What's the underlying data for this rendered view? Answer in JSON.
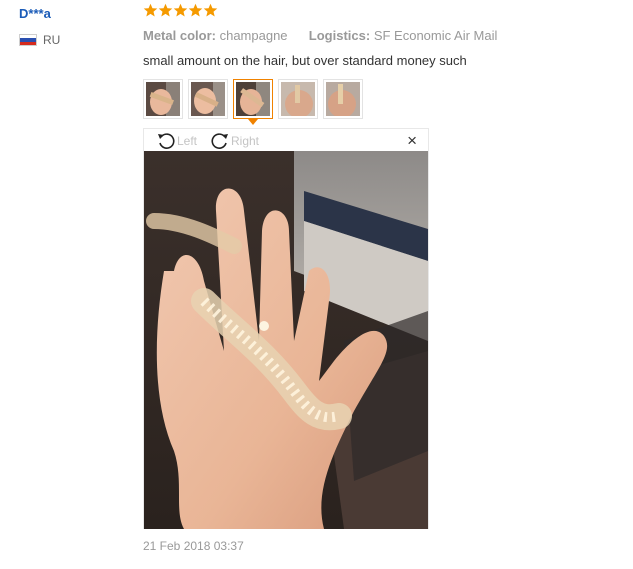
{
  "reviewer": {
    "name": "D***a",
    "country_code": "RU",
    "flag_colors": [
      "#ffffff",
      "#2a4fb0",
      "#d52b1e"
    ]
  },
  "rating": {
    "stars": 5,
    "max": 5,
    "color": "#f59a00"
  },
  "attributes": [
    {
      "key": "Metal color:",
      "value": "champagne"
    },
    {
      "key": "Logistics:",
      "value": "SF Economic Air Mail"
    }
  ],
  "review_text": "small amount on the hair, but over standard money such",
  "thumbnails": [
    {
      "icon": "review-photo-thumbnail",
      "active": false
    },
    {
      "icon": "review-photo-thumbnail",
      "active": false
    },
    {
      "icon": "review-photo-thumbnail",
      "active": true
    },
    {
      "icon": "review-photo-thumbnail",
      "active": false
    },
    {
      "icon": "review-photo-thumbnail",
      "active": false
    }
  ],
  "viewer": {
    "rotate_left_label": "Left",
    "rotate_right_label": "Right",
    "close_glyph": "×",
    "photo_icon": "hand-with-crystal-headband-photo"
  },
  "timestamp": "21 Feb 2018 03:37",
  "colors": {
    "link_blue": "#1a5bb8",
    "active_thumb_border": "#f08200",
    "muted_text": "#999999"
  }
}
